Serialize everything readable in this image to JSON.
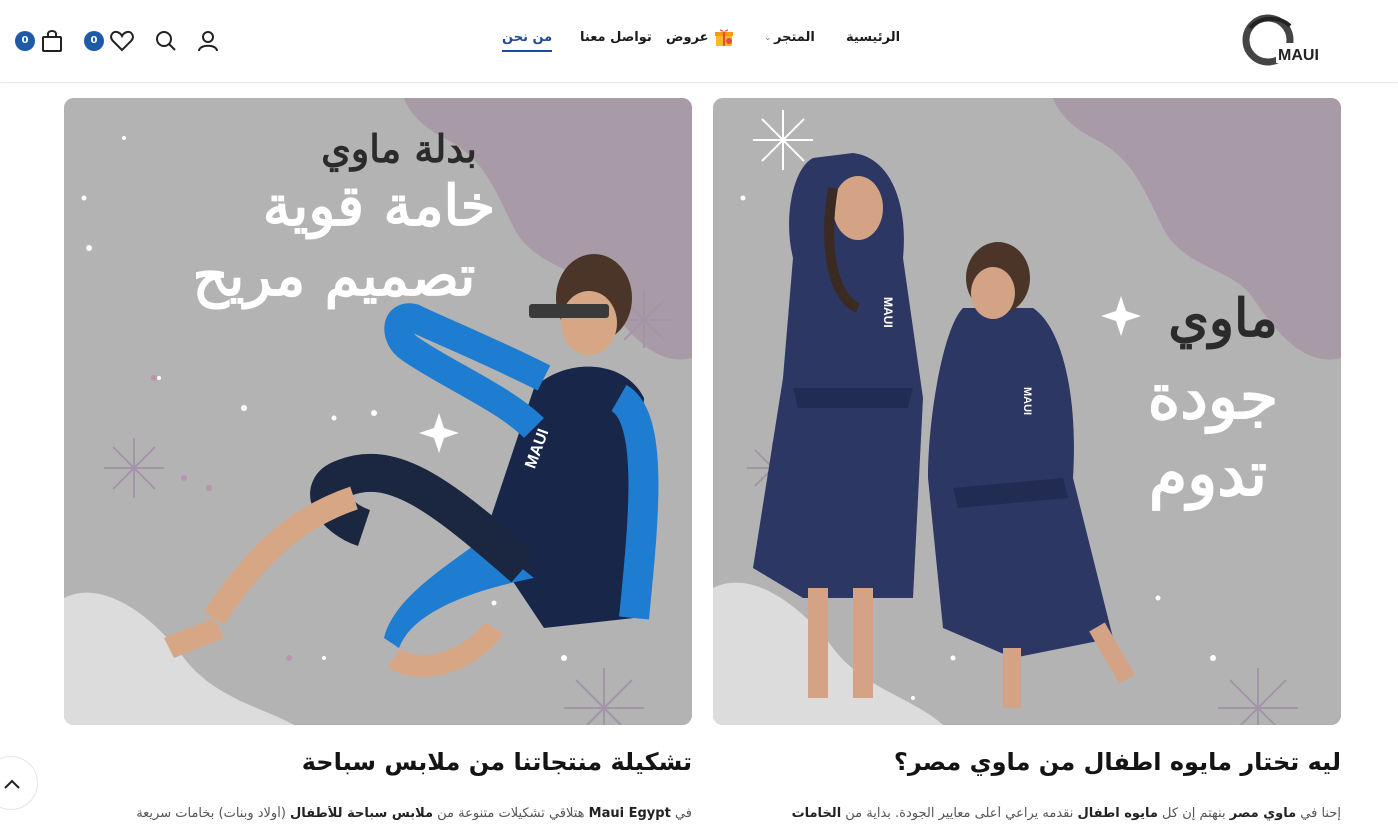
{
  "brand": {
    "logo_text": "MAUI"
  },
  "nav": {
    "home": "الرئيسية",
    "shop": "المتجر",
    "offers": "عروض",
    "contact": "تواصل معنا",
    "about": "من نحن"
  },
  "header_actions": {
    "wishlist_count": "0",
    "cart_count": "0"
  },
  "cards": {
    "left": {
      "line1": "بدلة ماوي",
      "line2": "خامة قوية",
      "line3": "تصميم مريح",
      "garment_text": "MAUI"
    },
    "right": {
      "line1": "ماوي",
      "line2": "جودة",
      "line3": "تدوم",
      "garment_text": "MAUI"
    }
  },
  "sections": {
    "left": {
      "heading": "تشكيلة منتجاتنا من ملابس سباحة",
      "para_pre": "في ",
      "para_b1": "Maui Egypt",
      "para_mid1": " هتلاقي تشكيلات متنوعة من ",
      "para_b2": "ملابس سباحة للأطفال",
      "para_post": " (أولاد وبنات) بخامات سريعة"
    },
    "right": {
      "heading": "ليه تختار مايوه اطفال من ماوي مصر؟",
      "para_pre": "إحنا في ",
      "para_b1": "ماوي مصر",
      "para_mid1": " بنهتم إن كل ",
      "para_b2": "مايوه اطفال",
      "para_mid2": " نقدمه يراعي أعلى معايير الجودة. بداية من ",
      "para_b3": "الخامات"
    }
  },
  "colors": {
    "accent": "#1f5aa6",
    "card_bg": "#b4b4b4",
    "blob": "#a99aa7",
    "navy": "#27325a"
  }
}
